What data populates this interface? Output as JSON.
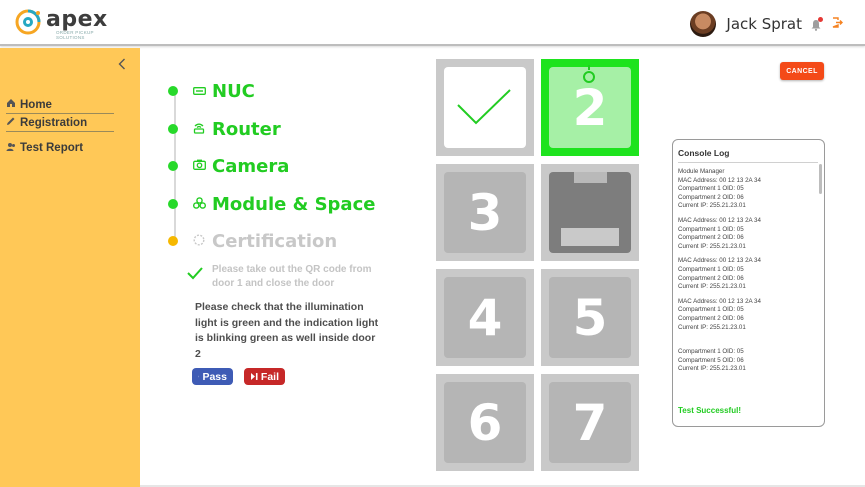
{
  "brand": {
    "name": "apex",
    "tagline": "ORDER PICKUP SOLUTIONS",
    "colors": {
      "accent": "#22cc22",
      "sidebar": "#ffc857",
      "logo_ring": "#f6a623",
      "logo_teal": "#27a8c2"
    }
  },
  "header": {
    "user_name": "Jack Sprat",
    "bell_icon": "bell-icon",
    "logout_icon": "logout-icon"
  },
  "sidebar": {
    "items": [
      {
        "label": "Home",
        "icon": "home-icon"
      },
      {
        "label": "Registration",
        "icon": "pencil-icon"
      },
      {
        "label": "Test Report",
        "icon": "users-icon"
      }
    ]
  },
  "steps": [
    {
      "label": "NUC",
      "icon": "nuc-icon",
      "status": "done"
    },
    {
      "label": "Router",
      "icon": "router-icon",
      "status": "done"
    },
    {
      "label": "Camera",
      "icon": "camera-icon",
      "status": "done"
    },
    {
      "label": "Module & Space",
      "icon": "module-icon",
      "status": "done"
    },
    {
      "label": "Certification",
      "icon": "spinner-icon",
      "status": "pending"
    }
  ],
  "certification": {
    "done_text": "Please take out the QR code from door 1 and close the door",
    "current_text": "Please check that the illumination light is green and the indication light is blinking green as well inside door 2",
    "pass_label": "Pass",
    "fail_label": "Fail"
  },
  "lockers": [
    {
      "number": "",
      "state": "done"
    },
    {
      "number": "2",
      "state": "active"
    },
    {
      "number": "3",
      "state": "idle"
    },
    {
      "number": "",
      "state": "closed"
    },
    {
      "number": "4",
      "state": "idle"
    },
    {
      "number": "5",
      "state": "idle"
    },
    {
      "number": "6",
      "state": "idle"
    },
    {
      "number": "7",
      "state": "idle"
    }
  ],
  "cancel_label": "CANCEL",
  "console": {
    "title": "Console Log",
    "blocks": [
      [
        "Module Manager",
        "MAC Address: 00 12 13 2A 34",
        "Compartment 1 OID: 05",
        "Compartment 2 OID: 06",
        "Current IP: 255.21.23.01"
      ],
      [
        "MAC Address: 00 12 13 2A 34",
        "Compartment 1 OID: 05",
        "Compartment 2 OID: 06",
        "Current IP: 255.21.23.01"
      ],
      [
        "MAC Address: 00 12 13 2A 34",
        "Compartment 1 OID: 05",
        "Compartment 2 OID: 06",
        "Current IP: 255.21.23.01"
      ],
      [
        "MAC Address: 00 12 13 2A 34",
        "Compartment 1 OID: 05",
        "Compartment 2 OID: 06",
        "Current IP: 255.21.23.01"
      ],
      [
        "Compartment 1 OID: 05",
        "Compartment 5 OID: 06",
        "Current IP: 255.21.23.01"
      ]
    ],
    "result": "Test Successful!"
  }
}
